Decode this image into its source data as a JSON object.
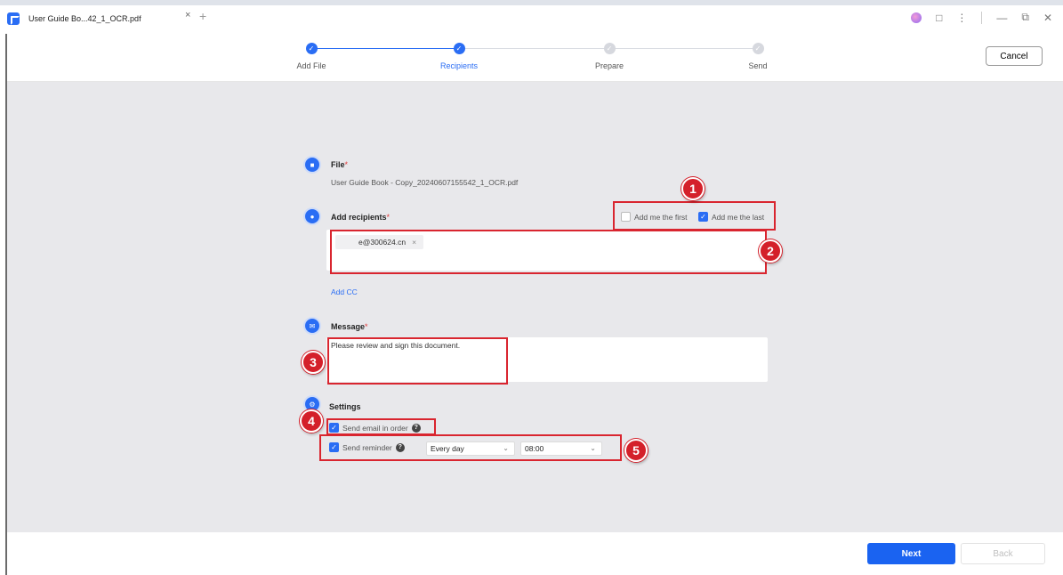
{
  "window": {
    "tab_title": "User Guide Bo...42_1_OCR.pdf",
    "tab_close": "×",
    "new_tab": "+",
    "controls": [
      "⋮",
      "—",
      "⧉",
      "✕"
    ]
  },
  "steps": [
    {
      "label": "Add File",
      "state": "done"
    },
    {
      "label": "Recipients",
      "state": "done",
      "active": true
    },
    {
      "label": "Prepare",
      "state": "todo"
    },
    {
      "label": "Send",
      "state": "todo"
    }
  ],
  "header": {
    "cancel_label": "Cancel"
  },
  "file": {
    "title": "File",
    "required": "*",
    "name": "User Guide Book - Copy_20240607155542_1_OCR.pdf"
  },
  "recipients": {
    "title": "Add recipients",
    "required": "*",
    "add_me_first_label": "Add me the first",
    "add_me_first_checked": false,
    "add_me_last_label": "Add me the last",
    "add_me_last_checked": true,
    "chip_email": "e@300624.cn",
    "chip_remove": "×",
    "add_cc_label": "Add CC"
  },
  "message": {
    "title": "Message",
    "required": "*",
    "value": "Please review and sign this document."
  },
  "settings": {
    "title": "Settings",
    "send_in_order_label": "Send email in order",
    "send_in_order_checked": true,
    "send_reminder_label": "Send reminder",
    "send_reminder_checked": true,
    "frequency": "Every day",
    "time": "08:00"
  },
  "annotations": [
    "1",
    "2",
    "3",
    "4",
    "5"
  ],
  "footer": {
    "next_label": "Next",
    "back_label": "Back"
  },
  "colors": {
    "accent": "#2a6df4",
    "annotation": "#d9252f",
    "background": "#e8e8eb"
  }
}
